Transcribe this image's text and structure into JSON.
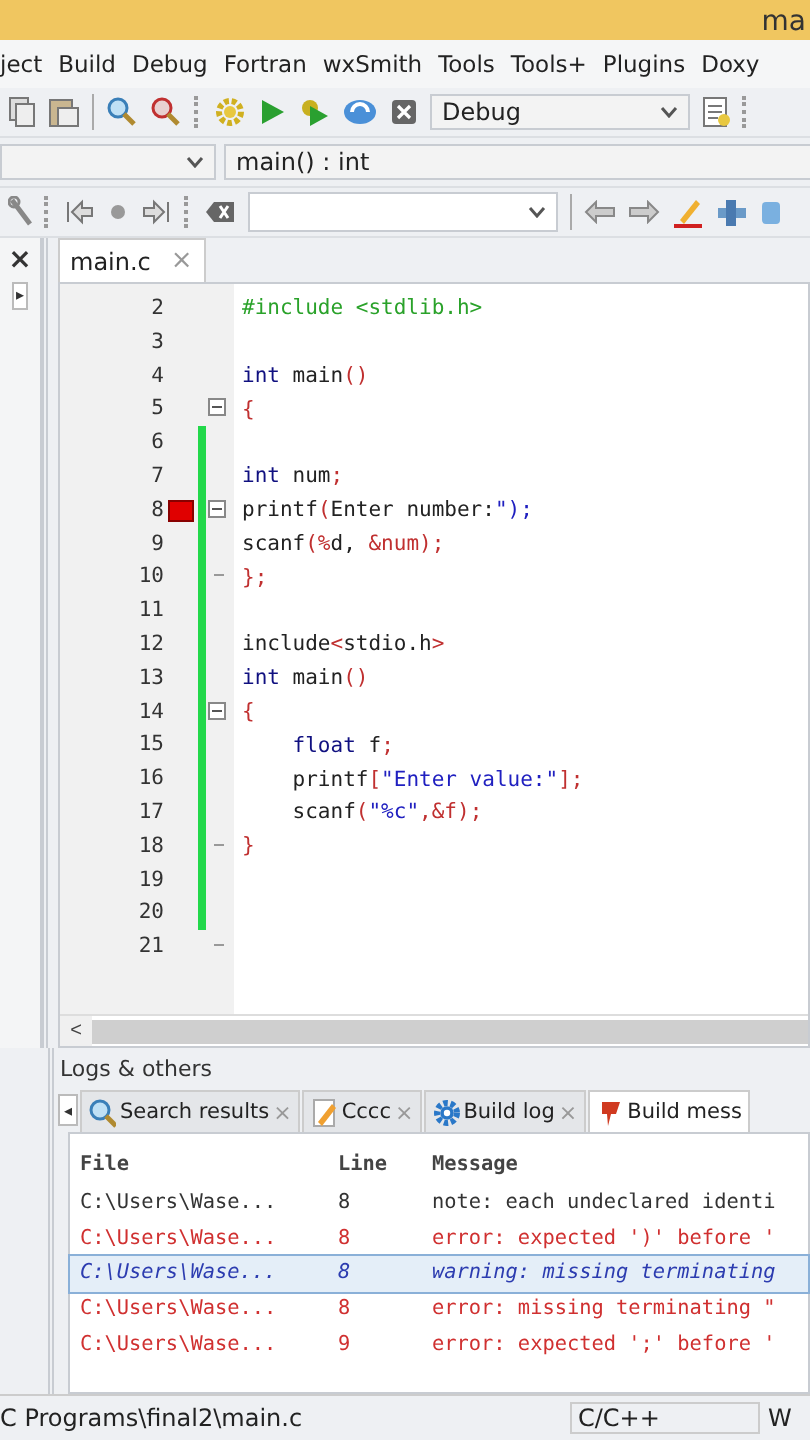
{
  "window": {
    "title": "ma"
  },
  "menu": [
    "ject",
    "Build",
    "Debug",
    "Fortran",
    "wxSmith",
    "Tools",
    "Tools+",
    "Plugins",
    "Doxy"
  ],
  "toolbar": {
    "build_target": "Debug"
  },
  "code_toolbar": {
    "function": "main() : int"
  },
  "left_panel": {
    "close": "×",
    "expand": "▸"
  },
  "editor": {
    "tabs": [
      {
        "label": "main.c",
        "close": "×",
        "selected": true
      }
    ],
    "lines": [
      {
        "number": "2",
        "changed": false,
        "fold_open": false,
        "fold_end": false,
        "marker": false,
        "tokens": [
          {
            "text": "#include <stdlib.h>",
            "kind": "preproc"
          }
        ]
      },
      {
        "number": "3",
        "changed": false,
        "fold_open": false,
        "fold_end": false,
        "marker": false
      },
      {
        "number": "4",
        "changed": false,
        "fold_open": false,
        "fold_end": false,
        "marker": false,
        "tokens": [
          {
            "text": "int",
            "kind": "keyword"
          },
          {
            "text": " main",
            "kind": "ident"
          },
          {
            "text": "()",
            "kind": "op"
          }
        ]
      },
      {
        "number": "5",
        "changed": false,
        "fold_open": true,
        "fold_end": false,
        "marker": false,
        "tokens": [
          {
            "text": "{",
            "kind": "op"
          }
        ]
      },
      {
        "number": "6",
        "changed": true,
        "fold_open": false,
        "fold_end": false,
        "marker": false
      },
      {
        "number": "7",
        "changed": true,
        "fold_open": false,
        "fold_end": false,
        "marker": false,
        "tokens": [
          {
            "text": "int",
            "kind": "keyword"
          },
          {
            "text": " num",
            "kind": "ident"
          },
          {
            "text": ";",
            "kind": "op"
          }
        ]
      },
      {
        "number": "8",
        "changed": true,
        "fold_open": true,
        "fold_end": false,
        "marker": true,
        "tokens": [
          {
            "text": "printf",
            "kind": "ident"
          },
          {
            "text": "(",
            "kind": "op"
          },
          {
            "text": "Enter number:",
            "kind": "ident"
          },
          {
            "text": "\");",
            "kind": "string"
          }
        ]
      },
      {
        "number": "9",
        "changed": true,
        "fold_open": false,
        "fold_end": false,
        "marker": false,
        "tokens": [
          {
            "text": "scanf",
            "kind": "ident"
          },
          {
            "text": "(%",
            "kind": "op"
          },
          {
            "text": "d, ",
            "kind": "ident"
          },
          {
            "text": "&num);",
            "kind": "op"
          }
        ]
      },
      {
        "number": "10",
        "changed": true,
        "fold_open": false,
        "fold_end": true,
        "marker": false,
        "tokens": [
          {
            "text": "};",
            "kind": "op"
          }
        ]
      },
      {
        "number": "11",
        "changed": true,
        "fold_open": false,
        "fold_end": false,
        "marker": false
      },
      {
        "number": "12",
        "changed": true,
        "fold_open": false,
        "fold_end": false,
        "marker": false,
        "tokens": [
          {
            "text": "include",
            "kind": "ident"
          },
          {
            "text": "<",
            "kind": "op"
          },
          {
            "text": "stdio.h",
            "kind": "ident"
          },
          {
            "text": ">",
            "kind": "op"
          }
        ]
      },
      {
        "number": "13",
        "changed": true,
        "fold_open": false,
        "fold_end": false,
        "marker": false,
        "tokens": [
          {
            "text": "int",
            "kind": "keyword"
          },
          {
            "text": " main",
            "kind": "ident"
          },
          {
            "text": "()",
            "kind": "op"
          }
        ]
      },
      {
        "number": "14",
        "changed": true,
        "fold_open": true,
        "fold_end": false,
        "marker": false,
        "tokens": [
          {
            "text": "{",
            "kind": "op"
          }
        ]
      },
      {
        "number": "15",
        "changed": true,
        "fold_open": false,
        "fold_end": false,
        "marker": false,
        "tokens": [
          {
            "text": "    float",
            "kind": "keyword"
          },
          {
            "text": " f",
            "kind": "ident"
          },
          {
            "text": ";",
            "kind": "op"
          }
        ]
      },
      {
        "number": "16",
        "changed": true,
        "fold_open": false,
        "fold_end": false,
        "marker": false,
        "tokens": [
          {
            "text": "    printf",
            "kind": "ident"
          },
          {
            "text": "[",
            "kind": "op"
          },
          {
            "text": "\"Enter value:\"",
            "kind": "string"
          },
          {
            "text": "];",
            "kind": "op"
          }
        ]
      },
      {
        "number": "17",
        "changed": true,
        "fold_open": false,
        "fold_end": false,
        "marker": false,
        "tokens": [
          {
            "text": "    scanf",
            "kind": "ident"
          },
          {
            "text": "(",
            "kind": "op"
          },
          {
            "text": "\"%c\"",
            "kind": "string"
          },
          {
            "text": ",&f);",
            "kind": "op"
          }
        ]
      },
      {
        "number": "18",
        "changed": true,
        "fold_open": false,
        "fold_end": true,
        "marker": false,
        "tokens": [
          {
            "text": "}",
            "kind": "op"
          }
        ]
      },
      {
        "number": "19",
        "changed": true,
        "fold_open": false,
        "fold_end": false,
        "marker": false
      },
      {
        "number": "20",
        "changed": true,
        "fold_open": false,
        "fold_end": false,
        "marker": false
      },
      {
        "number": "21",
        "changed": false,
        "fold_open": false,
        "fold_end": true,
        "marker": false
      }
    ],
    "scroll_left": "<"
  },
  "logs": {
    "title": "Logs & others",
    "scroll_left": "◂",
    "tabs": [
      {
        "label": "Search results",
        "close": "×",
        "selected": false
      },
      {
        "label": "Cccc",
        "close": "×",
        "selected": false
      },
      {
        "label": "Build log",
        "close": "×",
        "selected": false
      },
      {
        "label": "Build mess",
        "selected": true
      }
    ],
    "columns": [
      "File",
      "Line",
      "Message"
    ],
    "rows": [
      {
        "file": "C:\\Users\\Wase...",
        "line": "8",
        "message": "note: each undeclared identi",
        "kind": "note",
        "selected": false
      },
      {
        "file": "C:\\Users\\Wase...",
        "line": "8",
        "message": "error: expected ')' before '",
        "kind": "error",
        "selected": false
      },
      {
        "file": "C:\\Users\\Wase...",
        "line": "8",
        "message": "warning: missing terminating",
        "kind": "warning",
        "selected": true
      },
      {
        "file": "C:\\Users\\Wase...",
        "line": "8",
        "message": "error: missing terminating \"",
        "kind": "error",
        "selected": false
      },
      {
        "file": "C:\\Users\\Wase...",
        "line": "9",
        "message": "error: expected ';' before '",
        "kind": "error",
        "selected": false
      }
    ]
  },
  "status_bar": {
    "path": "C Programs\\final2\\main.c",
    "language": "C/C++",
    "extra": "W"
  }
}
